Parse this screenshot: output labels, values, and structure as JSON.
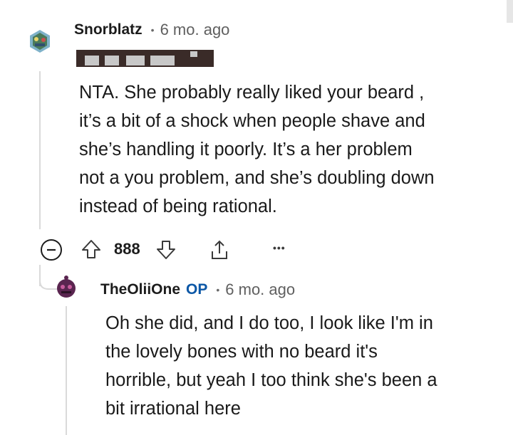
{
  "comment": {
    "username": "Snorblatz",
    "separator": "•",
    "timestamp": "6 mo. ago",
    "body_lines": [
      "NTA. She probably really liked your beard ,",
      "it’s a bit of a shock when people shave and",
      "she’s handling it poorly. It’s a her problem",
      "not a you problem, and she’s doubling down",
      "instead of being rational."
    ],
    "vote_count": "888",
    "more_label": "•••"
  },
  "reply": {
    "username": "TheOliiOne",
    "op_badge": "OP",
    "separator": "•",
    "timestamp": "6 mo. ago",
    "body_lines": [
      "Oh she did, and I do too, I look like I'm in",
      "the lovely bones with no beard it's",
      "horrible, but yeah I too think she's been a",
      "bit irrational here"
    ]
  },
  "colors": {
    "text": "#1c1c1c",
    "muted": "#5f5f5f",
    "op_badge": "#0b57a6",
    "thread_line": "#dadada"
  }
}
